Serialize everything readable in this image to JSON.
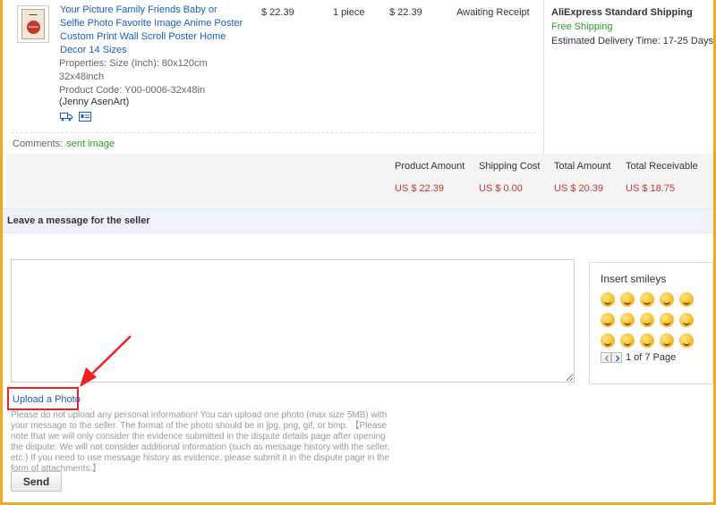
{
  "order": {
    "product_title": "Your Picture Family Friends Baby or Selfie Photo Favorite Image Anime Poster Custom Print Wall Scroll Poster Home Decor 14 Sizes",
    "thumb_label": "Custom Print",
    "properties": "Properties: Size (Inch): 80x120cm 32x48inch",
    "product_code": "Product Code: Y00-0006-32x48in",
    "seller": "(Jenny AsenArt)",
    "price": "$ 22.39",
    "quantity": "1 piece",
    "total": "$ 22.39",
    "status": "Awaiting Receipt",
    "shipping_name": "AliExpress Standard Shipping",
    "shipping_cost": "Free Shipping",
    "delivery_time": "Estimated Delivery Time:  17-25 Days",
    "comments_label": "Comments:",
    "comments_value": "sent image"
  },
  "totals": [
    {
      "label": "Product Amount",
      "value": "US $ 22.39"
    },
    {
      "label": "Shipping Cost",
      "value": "US $ 0.00"
    },
    {
      "label": "Total Amount",
      "value": "US $ 20.39"
    },
    {
      "label": "Total Receivable",
      "value": "US $ 18.75"
    }
  ],
  "message": {
    "header": "Leave a message for the seller",
    "upload_label": "Upload a Photo",
    "note": "Please do not upload any personal information! You can upload one photo (max size 5MB) with your message to the seller. The format of the photo should be in jpg, png, gif, or bmp. 【Please note that we will only consider the evidence submitted in the dispute details page after opening the dispute: We will not consider additional information (such as message history with the seller, etc.) If you need to use message history as evidence, please submit it in the dispute page in the form of attachments.】",
    "send_label": "Send"
  },
  "smileys": {
    "title": "Insert smileys",
    "pager_text": "1 of 7 Page",
    "count": 15
  },
  "colors": {
    "link": "#1a5cc8",
    "price_red": "#c0392b",
    "green": "#2a9d2a",
    "highlight_red": "#e22222",
    "frame_orange": "#f5a623"
  }
}
